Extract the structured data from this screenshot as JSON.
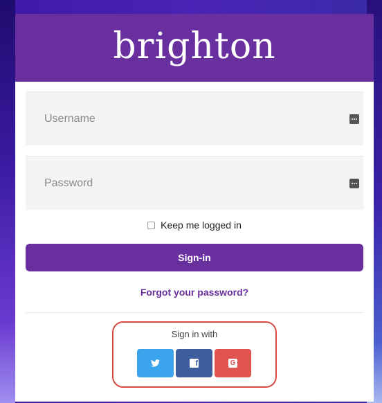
{
  "brand": {
    "name": "brighton"
  },
  "form": {
    "username_placeholder": "Username",
    "password_placeholder": "Password",
    "keep_logged_in_label": "Keep me logged in",
    "signin_label": "Sign-in",
    "forgot_link": "Forgot your password?"
  },
  "social": {
    "title": "Sign in with",
    "buttons": [
      {
        "icon": "twitter-icon",
        "color": "#3aa4ec"
      },
      {
        "icon": "facebook-icon",
        "color": "#3e5d9c"
      },
      {
        "icon": "google-icon",
        "color": "#e0554f"
      }
    ]
  },
  "colors": {
    "primary": "#6a2f9e",
    "highlight": "#d94a3f"
  }
}
